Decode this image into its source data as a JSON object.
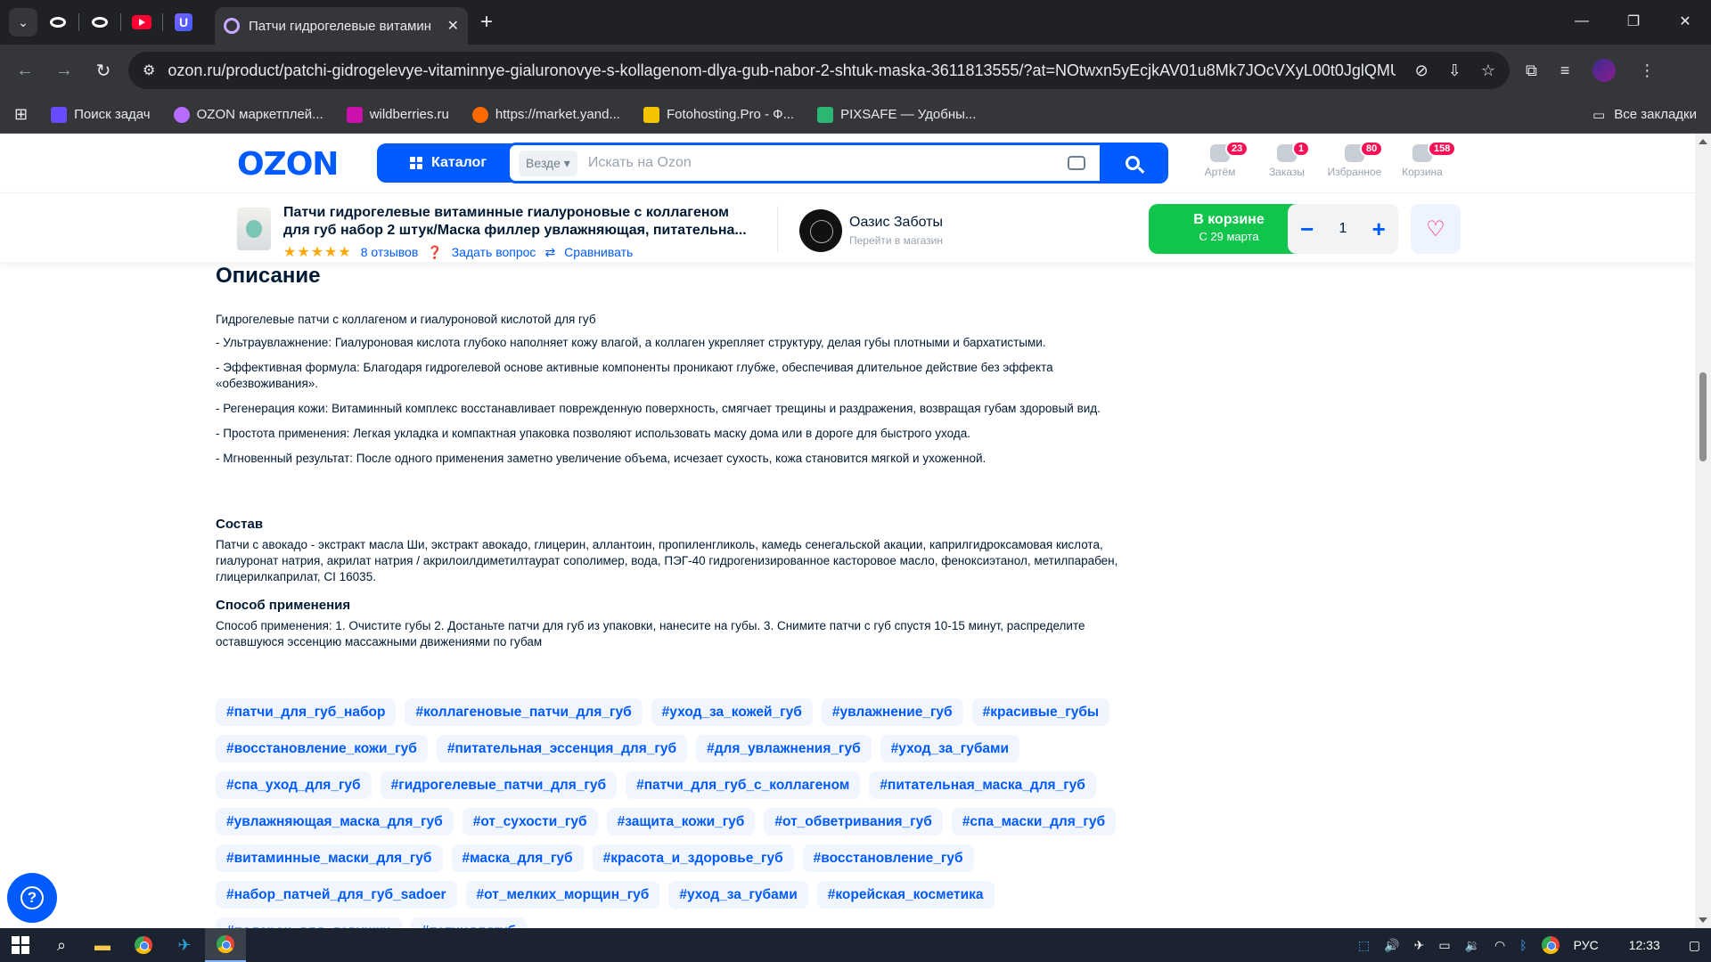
{
  "browser": {
    "tab_title": "Патчи гидрогелевые витамин",
    "url": "ozon.ru/product/patchi-gidrogelevye-vitaminnye-gialuronovye-s-kollagenom-dlya-gub-nabor-2-shtuk-maska-3611813555/?at=NOtwxn5yEcjkAV01u8Mk7JOcVXyL00t0JglQMU...",
    "bookmarks": [
      {
        "label": "Поиск задач",
        "color": "#6b4bff"
      },
      {
        "label": "OZON маркетплей...",
        "color": "#b76bff"
      },
      {
        "label": "wildberries.ru",
        "color": "#cb11ab"
      },
      {
        "label": "https://market.yand...",
        "color": "#ff6a00"
      },
      {
        "label": "Fotohosting.Pro - Ф...",
        "color": "#f5c400"
      },
      {
        "label": "PIXSAFE — Удобны...",
        "color": "#2bb673"
      }
    ],
    "all_bookmarks": "Все закладки"
  },
  "header": {
    "logo": "OZON",
    "catalog": "Каталог",
    "search_scope": "Везде",
    "search_placeholder": "Искать на Ozon",
    "items": [
      {
        "label": "Артём",
        "badge": "23"
      },
      {
        "label": "Заказы",
        "badge": "1"
      },
      {
        "label": "Избранное",
        "badge": "80"
      },
      {
        "label": "Корзина",
        "badge": "158"
      }
    ]
  },
  "product": {
    "title": "Патчи гидрогелевые витаминные гиалуроновые с коллагеном для губ набор 2 штук/Маска филлер увлажняющая, питательна...",
    "stars": "★★★★★",
    "reviews": "8 отзывов",
    "ask": "Задать вопрос",
    "compare": "Сравнивать",
    "seller_name": "Оазис Заботы",
    "seller_sub": "Перейти в магазин",
    "in_cart": "В корзине",
    "in_cart_date": "С 29 марта",
    "quantity": "1"
  },
  "description": {
    "heading": "Описание",
    "intro": "Гидрогелевые патчи с коллагеном и гиалуроновой кислотой для губ",
    "bullets": [
      "- Ультраувлажнение: Гиалуроновая кислота глубоко наполняет кожу влагой, а коллаген укрепляет структуру, делая губы плотными и бархатистыми.",
      "- Эффективная формула: Благодаря гидрогелевой основе активные компоненты проникают глубже, обеспечивая длительное действие без эффекта «обезвоживания».",
      "- Регенерация кожи: Витаминный комплекс восстанавливает поврежденную поверхность, смягчает трещины и раздражения, возвращая губам здоровый вид.",
      "- Простота применения: Легкая укладка и компактная упаковка позволяют использовать маску дома или в дороге для быстрого ухода.",
      "- Мгновенный результат: После одного применения заметно увеличение объема, исчезает сухость, кожа становится мягкой и ухоженной."
    ],
    "composition_heading": "Состав",
    "composition": "Патчи с авокадо - экстракт масла Ши, экстракт авокадо, глицерин, аллантоин, пропиленгликоль, камедь сенегальской акации, каприлгидроксамовая кислота, гиалуронат натрия, акрилат натрия / акрилоилдиметилтаурат сополимер, вода, ПЭГ-40 гидрогенизированное касторовое масло, феноксиэтанол, метилпарабен, глицерилкаприлат, CI 16035.",
    "usage_heading": "Способ применения",
    "usage": "Способ применения: 1. Очистите губы 2. Достаньте патчи для губ из упаковки, нанесите на губы. 3. Снимите патчи с губ спустя 10-15 минут, распределите оставшуюся эссенцию массажными движениями по губам"
  },
  "tags": [
    "#патчи_для_губ_набор",
    "#коллагеновые_патчи_для_губ",
    "#уход_за_кожей_губ",
    "#увлажнение_губ",
    "#красивые_губы",
    "#восстановление_кожи_губ",
    "#питательная_эссенция_для_губ",
    "#для_увлажнения_губ",
    "#уход_за_губами",
    "#спа_уход_для_губ",
    "#гидрогелевые_патчи_для_губ",
    "#патчи_для_губ_с_коллагеном",
    "#питательная_маска_для_губ",
    "#увлажняющая_маска_для_губ",
    "#от_сухости_губ",
    "#защита_кожи_губ",
    "#от_обветривания_губ",
    "#спа_маски_для_губ",
    "#витаминные_маски_для_губ",
    "#маска_для_губ",
    "#красота_и_здоровье_губ",
    "#восстановление_губ",
    "#набор_патчей_для_губ_sadoer",
    "#от_мелких_морщин_губ",
    "#уход_за_губами",
    "#корейская_косметика",
    "#подарок_для_девушки",
    "#патчидлягуб"
  ],
  "taskbar": {
    "lang": "РУС",
    "time": "12:33"
  },
  "colors": {
    "ozon_blue": "#005bff",
    "cart_green": "#10c44c",
    "badge_pink": "#f91155"
  }
}
